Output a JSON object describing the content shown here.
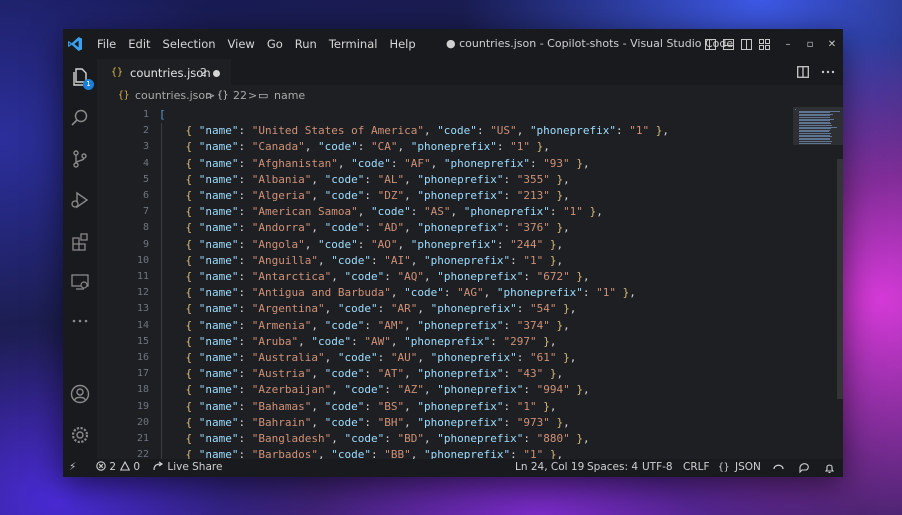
{
  "window_title": "● countries.json - Copilot-shots - Visual Studio Code",
  "menu": [
    "File",
    "Edit",
    "Selection",
    "View",
    "Go",
    "Run",
    "Terminal",
    "Help"
  ],
  "window_controls": {
    "minimize": "–",
    "maximize": "▫",
    "close": "✕"
  },
  "activity_bar": {
    "explorer_badge": "1"
  },
  "tab": {
    "icon": "{}",
    "name": "countries.json",
    "count": "2"
  },
  "breadcrumb": {
    "file_icon": "{}",
    "file": "countries.json",
    "sep1": ">",
    "obj_icon": "{}",
    "obj": "22",
    "sep2": ">",
    "prop_icon": "▭",
    "prop": "name"
  },
  "code_lines": [
    {
      "n": "1",
      "t": "["
    },
    {
      "n": "2",
      "name": "United States of America",
      "code": "US",
      "phone": "1",
      "trail": ","
    },
    {
      "n": "3",
      "name": "Canada",
      "code": "CA",
      "phone": "1",
      "trail": ","
    },
    {
      "n": "4",
      "name": "Afghanistan",
      "code": "AF",
      "phone": "93",
      "trail": ","
    },
    {
      "n": "5",
      "name": "Albania",
      "code": "AL",
      "phone": "355",
      "trail": ","
    },
    {
      "n": "6",
      "name": "Algeria",
      "code": "DZ",
      "phone": "213",
      "trail": ","
    },
    {
      "n": "7",
      "name": "American Samoa",
      "code": "AS",
      "phone": "1",
      "trail": ","
    },
    {
      "n": "8",
      "name": "Andorra",
      "code": "AD",
      "phone": "376",
      "trail": ","
    },
    {
      "n": "9",
      "name": "Angola",
      "code": "AO",
      "phone": "244",
      "trail": ","
    },
    {
      "n": "10",
      "name": "Anguilla",
      "code": "AI",
      "phone": "1",
      "trail": ","
    },
    {
      "n": "11",
      "name": "Antarctica",
      "code": "AQ",
      "phone": "672",
      "trail": ","
    },
    {
      "n": "12",
      "name": "Antigua and Barbuda",
      "code": "AG",
      "phone": "1",
      "trail": ","
    },
    {
      "n": "13",
      "name": "Argentina",
      "code": "AR",
      "phone": "54",
      "trail": ","
    },
    {
      "n": "14",
      "name": "Armenia",
      "code": "AM",
      "phone": "374",
      "trail": ","
    },
    {
      "n": "15",
      "name": "Aruba",
      "code": "AW",
      "phone": "297",
      "trail": ","
    },
    {
      "n": "16",
      "name": "Australia",
      "code": "AU",
      "phone": "61",
      "trail": ","
    },
    {
      "n": "17",
      "name": "Austria",
      "code": "AT",
      "phone": "43",
      "trail": ","
    },
    {
      "n": "18",
      "name": "Azerbaijan",
      "code": "AZ",
      "phone": "994",
      "trail": ","
    },
    {
      "n": "19",
      "name": "Bahamas",
      "code": "BS",
      "phone": "1",
      "trail": ","
    },
    {
      "n": "20",
      "name": "Bahrain",
      "code": "BH",
      "phone": "973",
      "trail": ","
    },
    {
      "n": "21",
      "name": "Bangladesh",
      "code": "BD",
      "phone": "880",
      "trail": ","
    },
    {
      "n": "22",
      "name": "Barbados",
      "code": "BB",
      "phone": "1",
      "trail": ","
    }
  ],
  "status": {
    "remote_icon": "⚡",
    "errors": "2",
    "warnings": "0",
    "live_share": "Live Share",
    "position": "Ln 24, Col 19",
    "spaces": "Spaces: 4",
    "encoding": "UTF-8",
    "eol": "CRLF",
    "lang_icon": "{}",
    "language": "JSON"
  }
}
